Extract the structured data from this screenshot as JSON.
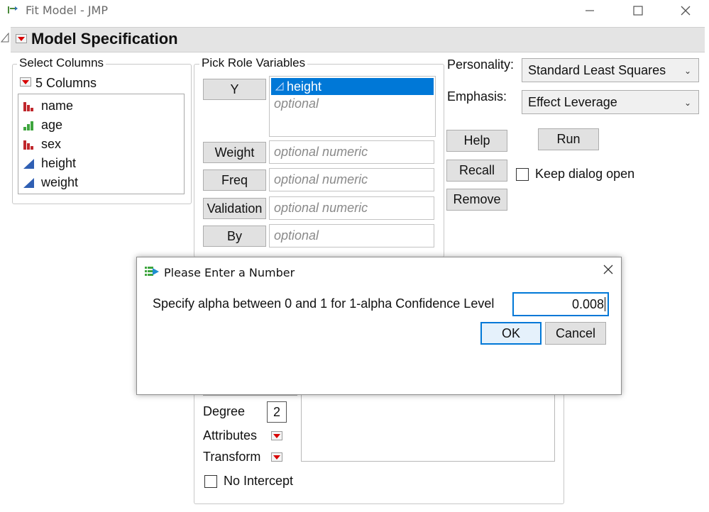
{
  "window": {
    "title": "Fit Model - JMP",
    "controls": [
      "minimize-icon",
      "maximize-icon",
      "close-icon"
    ]
  },
  "model_spec": {
    "title": "Model Specification"
  },
  "select_columns": {
    "label": "Select Columns",
    "count_label": "5 Columns",
    "items": [
      {
        "name": "name",
        "icon": "nominal-icon",
        "color": "#c0282d"
      },
      {
        "name": "age",
        "icon": "ordinal-icon",
        "color": "#3ea53e"
      },
      {
        "name": "sex",
        "icon": "nominal-icon",
        "color": "#c0282d"
      },
      {
        "name": "height",
        "icon": "continuous-icon",
        "color": "#2f5fb3"
      },
      {
        "name": "weight",
        "icon": "continuous-icon",
        "color": "#2f5fb3"
      }
    ]
  },
  "pick_roles": {
    "label": "Pick Role Variables",
    "y": {
      "button": "Y",
      "selected": "height",
      "placeholder": "optional"
    },
    "weight": {
      "button": "Weight",
      "placeholder": "optional numeric"
    },
    "freq": {
      "button": "Freq",
      "placeholder": "optional numeric"
    },
    "validation": {
      "button": "Validation",
      "placeholder": "optional numeric"
    },
    "by": {
      "button": "By",
      "placeholder": "optional"
    }
  },
  "personality": {
    "label": "Personality:",
    "value": "Standard Least Squares"
  },
  "emphasis": {
    "label": "Emphasis:",
    "value": "Effect Leverage"
  },
  "actions": {
    "help": "Help",
    "run": "Run",
    "recall": "Recall",
    "remove": "Remove",
    "keep_open": "Keep dialog open"
  },
  "construct": {
    "degree_label": "Degree",
    "degree_value": "2",
    "attributes": "Attributes",
    "transform": "Transform",
    "no_intercept": "No Intercept"
  },
  "dialog": {
    "title": "Please Enter a Number",
    "prompt": "Specify alpha between 0 and 1 for 1-alpha Confidence Level",
    "value": "0.008",
    "ok": "OK",
    "cancel": "Cancel"
  },
  "colors": {
    "accent_blue": "#0078d7",
    "menu_red": "#d80000",
    "selection": "#0078d7"
  }
}
